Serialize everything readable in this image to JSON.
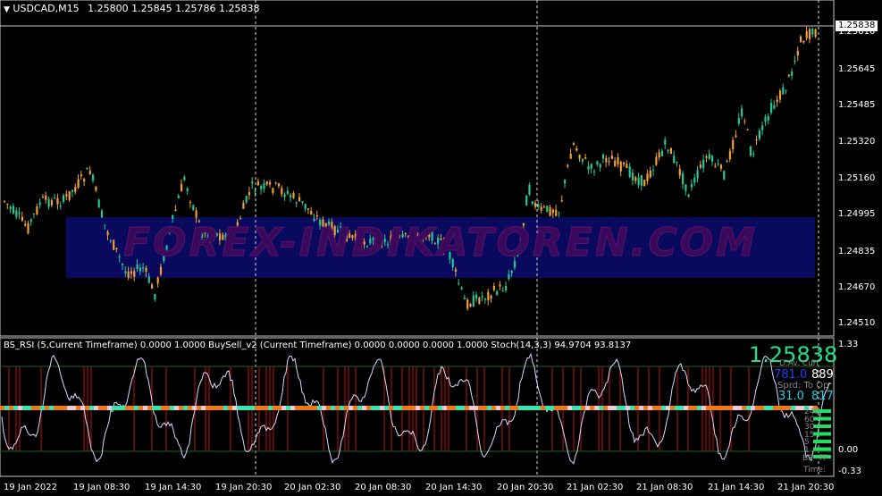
{
  "main_chart": {
    "symbol_header": "USDCAD,M15",
    "ohlc": "1.25800 1.25845 1.25786 1.25838",
    "watermark": "FOREX-INDIKATOREN.COM",
    "current_price": "1.25838",
    "price_axis": [
      "1.25810",
      "1.25645",
      "1.25485",
      "1.25320",
      "1.25160",
      "1.24995",
      "1.24835",
      "1.24670",
      "1.24510"
    ],
    "colors": {
      "bull": "#20c997",
      "bear": "#f0a030",
      "grid": "#c8c8c8",
      "watermark_bg": "#0a0a6e",
      "watermark_text": "#3a0a5a"
    }
  },
  "indicator": {
    "header": "BS_RSI (5,Current Timeframe) 0.0000 1.0000  BuySell_v2 (Current Timeframe) 0.0000 0.0000 0.0000 1.0000  Stoch(14,3,3) 94.9704 93.8137",
    "axis": [
      "1.33",
      "0.00",
      "-0.33"
    ],
    "big_price": "1.25838",
    "stats": {
      "row1_label": "D.Av.",
      "row1_label2": "Curr",
      "row1_val1": "781.0",
      "row1_val2": "889",
      "row2_label": "Sprd:",
      "row2_label2": "To Op",
      "row2_val1": "31.0",
      "row2_val2": "817"
    },
    "bars_labels": [
      "240",
      "60",
      "30",
      "15",
      "5",
      "1"
    ],
    "bs_label": "BS",
    "tf_label": "TF",
    "time_label": "Time:"
  },
  "time_axis": [
    "19 Jan 2022",
    "19 Jan 08:30",
    "19 Jan 14:30",
    "19 Jan 20:30",
    "20 Jan 02:30",
    "20 Jan 08:30",
    "20 Jan 14:30",
    "20 Jan 20:30",
    "21 Jan 02:30",
    "21 Jan 08:30",
    "21 Jan 14:30",
    "21 Jan 20:30"
  ]
}
